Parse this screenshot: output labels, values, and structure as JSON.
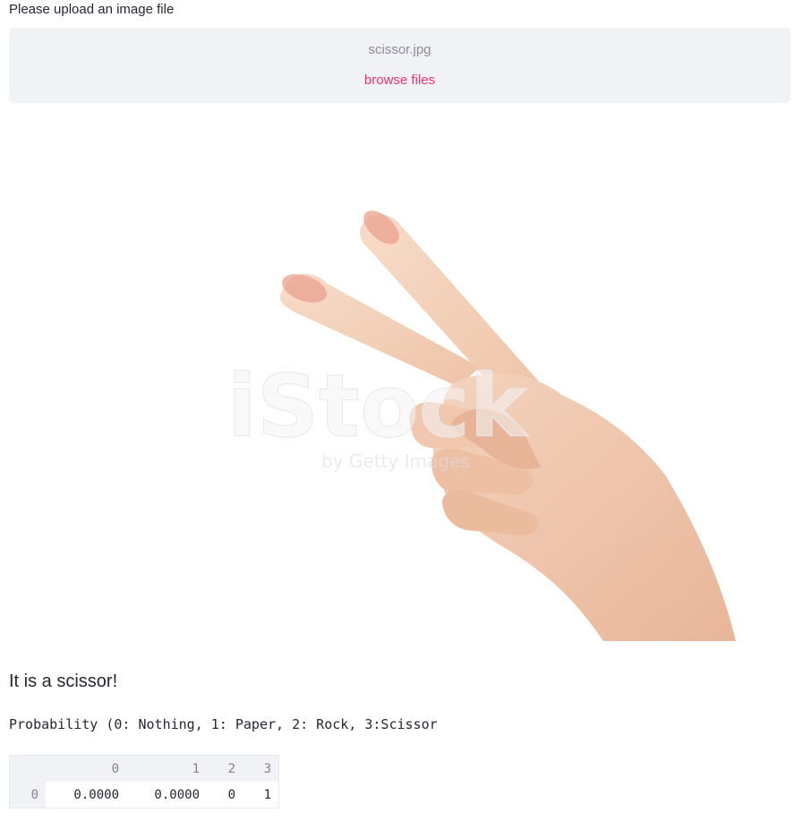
{
  "uploader": {
    "label": "Please upload an image file",
    "file_name": "scissor.jpg",
    "browse_label": "browse files",
    "accent_color": "#f63366"
  },
  "image": {
    "watermark_text": "iStock",
    "watermark_sub": "by Getty Images"
  },
  "result": {
    "text": "It is a scissor!"
  },
  "probability": {
    "caption": "Probability (0: Nothing, 1: Paper, 2: Rock, 3:Scissor"
  },
  "dataframe": {
    "columns": [
      "0",
      "1",
      "2",
      "3"
    ],
    "rows": [
      {
        "index": "0",
        "values": [
          "0.0000",
          "0.0000",
          "0",
          "1"
        ]
      }
    ]
  }
}
